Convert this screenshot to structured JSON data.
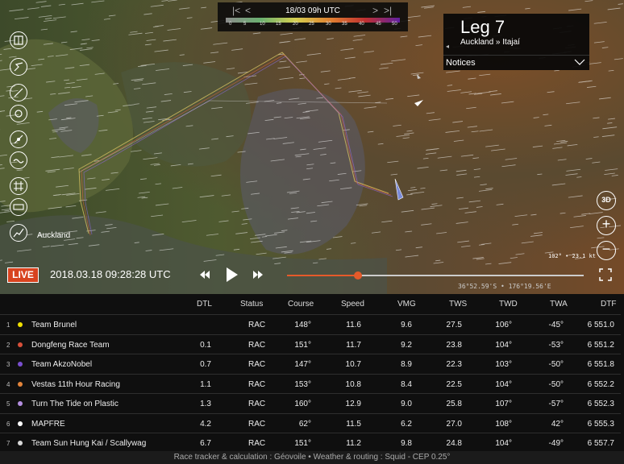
{
  "time": {
    "date": "18/03 09h UTC",
    "scale_labels": [
      "0",
      "5",
      "10",
      "15",
      "20",
      "25",
      "30",
      "35",
      "40",
      "45",
      "50"
    ]
  },
  "leg": {
    "title": "Leg 7",
    "route": "Auckland » Itajaí",
    "notices_label": "Notices"
  },
  "map": {
    "place_label": "Auckland",
    "scale_text": "102° • 23.1 kt",
    "coords": "36°52.59'S • 176°19.56'E"
  },
  "controls": {
    "btn_3d": "3D",
    "zoom_in": "+",
    "zoom_out": "−",
    "live_label": "LIVE",
    "datetime": "2018.03.18 09:28:28 UTC",
    "progress": 0.24
  },
  "tools": [
    "book-icon",
    "route-icon",
    "compass-icon",
    "boat-icon",
    "wind-icon",
    "wave-icon",
    "grid-icon",
    "ruler-icon",
    "graph-icon"
  ],
  "table": {
    "headers": [
      "DTL",
      "Status",
      "Course",
      "Speed",
      "VMG",
      "TWS",
      "TWD",
      "TWA",
      "DTF"
    ],
    "rows": [
      {
        "rank": "1",
        "color": "#f1e000",
        "team": "Team Brunel",
        "dtl": "",
        "status": "RAC",
        "course": "148°",
        "speed": "11.6",
        "vmg": "9.6",
        "tws": "27.5",
        "twd": "106°",
        "twa": "-45°",
        "dtf": "6 551.0"
      },
      {
        "rank": "2",
        "color": "#d9503a",
        "team": "Dongfeng Race Team",
        "dtl": "0.1",
        "status": "RAC",
        "course": "151°",
        "speed": "11.7",
        "vmg": "9.2",
        "tws": "23.8",
        "twd": "104°",
        "twa": "-53°",
        "dtf": "6 551.2"
      },
      {
        "rank": "3",
        "color": "#7a4fd0",
        "team": "Team AkzoNobel",
        "dtl": "0.7",
        "status": "RAC",
        "course": "147°",
        "speed": "10.7",
        "vmg": "8.9",
        "tws": "22.3",
        "twd": "103°",
        "twa": "-50°",
        "dtf": "6 551.8"
      },
      {
        "rank": "4",
        "color": "#e3843a",
        "team": "Vestas 11th Hour Racing",
        "dtl": "1.1",
        "status": "RAC",
        "course": "153°",
        "speed": "10.8",
        "vmg": "8.4",
        "tws": "22.5",
        "twd": "104°",
        "twa": "-50°",
        "dtf": "6 552.2"
      },
      {
        "rank": "5",
        "color": "#b48ee0",
        "team": "Turn The Tide on Plastic",
        "dtl": "1.3",
        "status": "RAC",
        "course": "160°",
        "speed": "12.9",
        "vmg": "9.0",
        "tws": "25.8",
        "twd": "107°",
        "twa": "-57°",
        "dtf": "6 552.3"
      },
      {
        "rank": "6",
        "color": "#ffffff",
        "team": "MAPFRE",
        "dtl": "4.2",
        "status": "RAC",
        "course": "62°",
        "speed": "11.5",
        "vmg": "6.2",
        "tws": "27.0",
        "twd": "108°",
        "twa": "42°",
        "dtf": "6 555.3"
      },
      {
        "rank": "7",
        "color": "#d8d8d8",
        "team": "Team Sun Hung Kai / Scallywag",
        "dtl": "6.7",
        "status": "RAC",
        "course": "151°",
        "speed": "11.2",
        "vmg": "9.8",
        "tws": "24.8",
        "twd": "104°",
        "twa": "-49°",
        "dtf": "6 557.7"
      }
    ]
  },
  "footer": "Race tracker & calculation : Géovoile • Weather & routing : Squid - CEP 0.25°",
  "colors": {
    "live": "#d8431f",
    "progress": "#e65a2a"
  }
}
